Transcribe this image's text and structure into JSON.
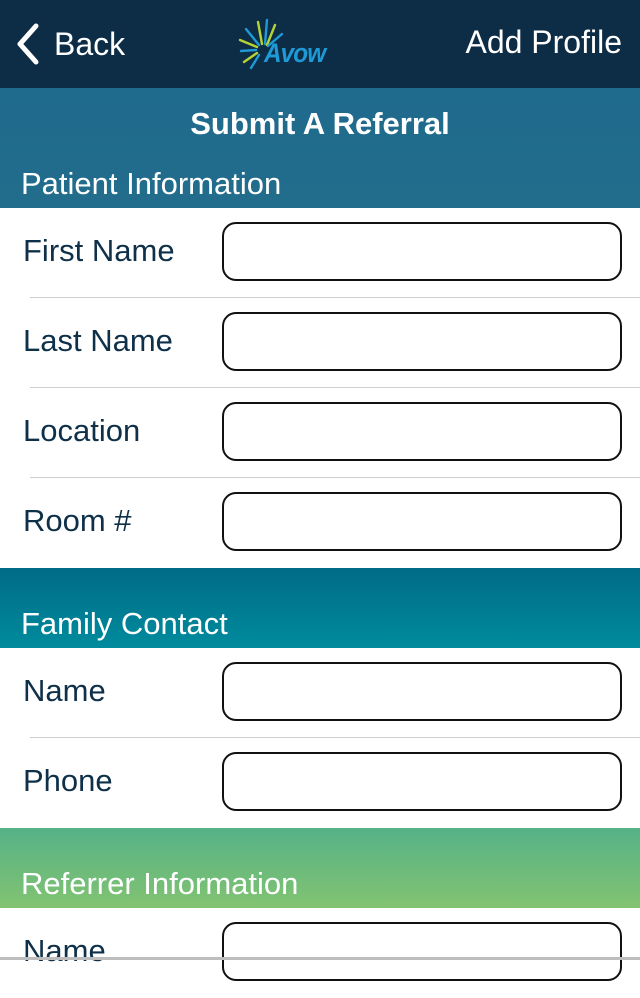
{
  "navbar": {
    "back_label": "Back",
    "logo_text": "Avow",
    "add_profile_label": "Add Profile",
    "background": "#0d2c46"
  },
  "header": {
    "title": "Submit A Referral"
  },
  "sections": [
    {
      "title": "Patient Information",
      "fields": [
        {
          "label": "First Name",
          "value": "",
          "placeholder": ""
        },
        {
          "label": "Last Name",
          "value": "",
          "placeholder": ""
        },
        {
          "label": "Location",
          "value": "",
          "placeholder": ""
        },
        {
          "label": "Room #",
          "value": "",
          "placeholder": ""
        }
      ]
    },
    {
      "title": "Family Contact",
      "fields": [
        {
          "label": "Name",
          "value": "",
          "placeholder": ""
        },
        {
          "label": "Phone",
          "value": "",
          "placeholder": ""
        }
      ]
    },
    {
      "title": "Referrer Information",
      "fields": [
        {
          "label": "Name",
          "value": "",
          "placeholder": ""
        }
      ]
    }
  ],
  "colors": {
    "patient_section": "#1f6b8d",
    "family_section": "#008b9d",
    "referrer_section": "#82c371",
    "label_text": "#0e3049",
    "logo_blue": "#1e9ad6",
    "logo_green": "#b5d334"
  }
}
